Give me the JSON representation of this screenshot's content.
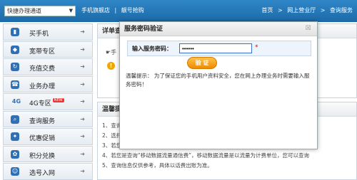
{
  "topbar": {
    "channel_select": "快捷办理通道",
    "nav": [
      "手机旗舰店",
      "|",
      "靓号抢购"
    ],
    "crumbs": [
      "首页",
      ">",
      "网上营业厅",
      ">",
      "查询服务"
    ]
  },
  "sidebar": {
    "items": [
      {
        "label": "买手机",
        "icon": "phone-icon"
      },
      {
        "label": "宽带专区",
        "icon": "broadband-icon"
      },
      {
        "label": "充值交费",
        "icon": "recharge-icon"
      },
      {
        "label": "业务办理",
        "icon": "business-icon"
      },
      {
        "label": "4G专区",
        "icon": "4g-icon",
        "badge": "NEW"
      },
      {
        "label": "查询服务",
        "icon": "search-icon"
      },
      {
        "label": "优惠促销",
        "icon": "tag-icon"
      },
      {
        "label": "积分兑换",
        "icon": "points-icon"
      },
      {
        "label": "选号入网",
        "icon": "number-icon"
      }
    ]
  },
  "main": {
    "box1_title": "详单查",
    "box1_line": "手",
    "box2_title": "温馨提",
    "tips": [
      "1、查询",
      "2、选择",
      "3、若您",
      "4、若您是查询“移动数据流量通信费”，移动数据流量是以流量为计费单位，您可以查询",
      "5、查询信息仅供参考，具体以话费出账为准。"
    ]
  },
  "modal": {
    "title": "服务密码验证",
    "close": "☒",
    "label": "输入服务密码：",
    "password_value": "••••••",
    "required_mark": "*",
    "button": "验 证",
    "tip": "温馨提示： 为了保证您的手机用户资料安全，您在网上办理业务时需要输入服务密码！"
  }
}
